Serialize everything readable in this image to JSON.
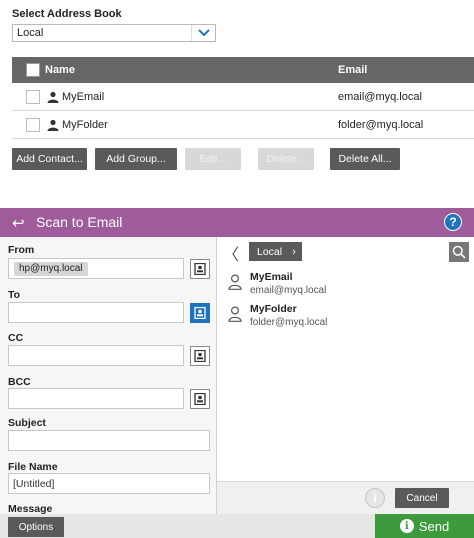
{
  "address_book": {
    "label": "Select Address Book",
    "selected": "Local",
    "columns": {
      "name": "Name",
      "email": "Email"
    },
    "rows": [
      {
        "name": "MyEmail",
        "email": "email@myq.local"
      },
      {
        "name": "MyFolder",
        "email": "folder@myq.local"
      }
    ],
    "buttons": {
      "add_contact": "Add Contact...",
      "add_group": "Add Group...",
      "edit": "Edit...",
      "delete": "Delete...",
      "delete_all": "Delete All..."
    }
  },
  "scan": {
    "header": {
      "title": "Scan to Email",
      "back_icon": "↩",
      "help": "?"
    },
    "fields": {
      "from_label": "From",
      "from_value": "hp@myq.local",
      "to_label": "To",
      "cc_label": "CC",
      "bcc_label": "BCC",
      "subject_label": "Subject",
      "filename_label": "File Name",
      "filename_value": "[Untitled]",
      "message_label": "Message"
    },
    "contacts": {
      "back": "〈",
      "crumb": "Local",
      "crumb_arrow": "›",
      "items": [
        {
          "name": "MyEmail",
          "email": "email@myq.local"
        },
        {
          "name": "MyFolder",
          "email": "folder@myq.local"
        }
      ],
      "info": "i",
      "cancel": "Cancel"
    },
    "footer": {
      "options": "Options",
      "send": "Send",
      "send_icon": "i"
    }
  },
  "colors": {
    "header_bg": "#a05b9a",
    "accent_blue": "#1e73be",
    "send_green": "#3d9a3d",
    "button_gray": "#5a5a5a",
    "table_head": "#666666"
  }
}
